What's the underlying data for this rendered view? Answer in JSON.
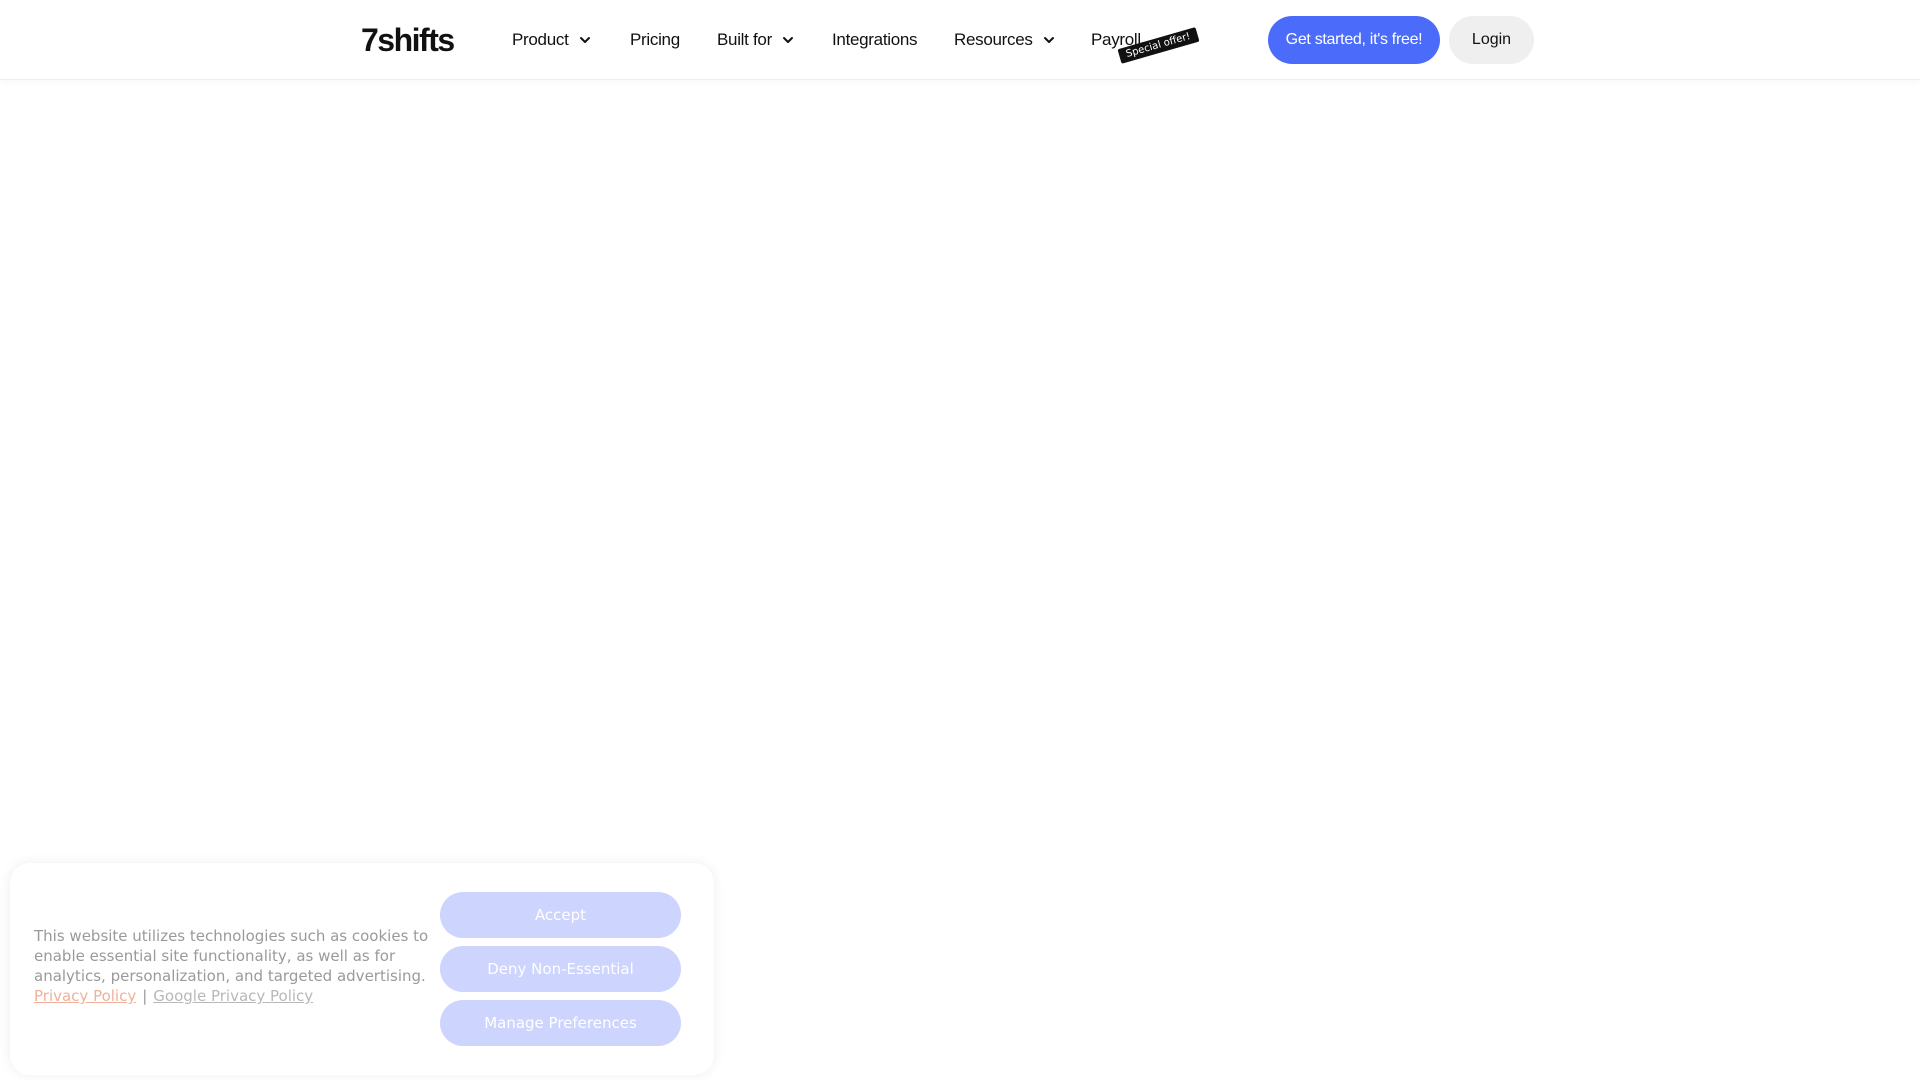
{
  "header": {
    "logo": "7shifts",
    "nav": [
      {
        "label": "Product",
        "dropdown": true
      },
      {
        "label": "Pricing",
        "dropdown": false
      },
      {
        "label": "Built for",
        "dropdown": true
      },
      {
        "label": "Integrations",
        "dropdown": false
      },
      {
        "label": "Resources",
        "dropdown": true
      },
      {
        "label": "Payroll",
        "dropdown": false
      }
    ],
    "payroll_badge": "Special offer!",
    "cta_label": "Get started, it's free!",
    "login_label": "Login"
  },
  "cookie_banner": {
    "message": "This website utilizes technologies such as cookies to enable essential site functionality, as well as for analytics, personalization, and targeted advertising.",
    "privacy_link": "Privacy Policy",
    "separator": "|",
    "google_link": "Google Privacy Policy",
    "accept_label": "Accept",
    "deny_label": "Deny Non-Essential",
    "manage_label": "Manage Preferences"
  },
  "colors": {
    "primary": "#4b6bfb",
    "cookie_button": "#cdd4fd",
    "privacy_link": "#f0b09a"
  }
}
